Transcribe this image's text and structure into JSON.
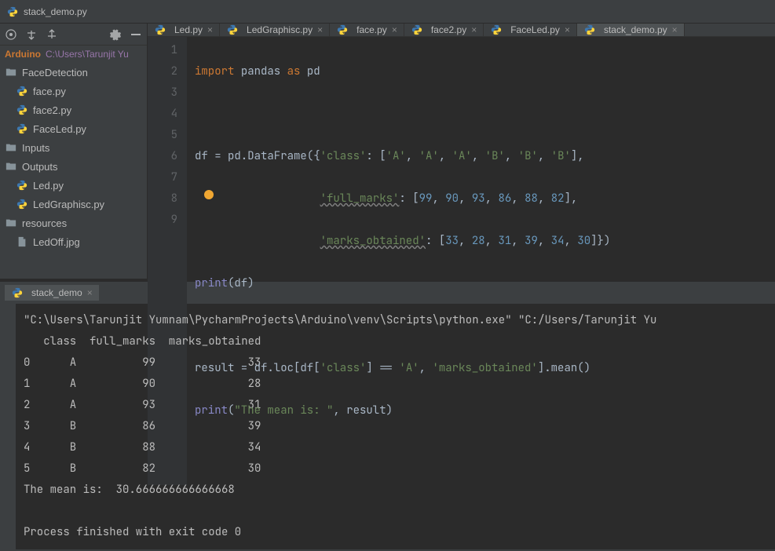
{
  "window": {
    "title": "stack_demo.py"
  },
  "project": {
    "name": "Arduino",
    "path": "C:\\Users\\Tarunjit Yu"
  },
  "tree": [
    {
      "type": "folder",
      "label": "FaceDetection",
      "indent": 0
    },
    {
      "type": "py",
      "label": "face.py",
      "indent": 1
    },
    {
      "type": "py",
      "label": "face2.py",
      "indent": 1
    },
    {
      "type": "py",
      "label": "FaceLed.py",
      "indent": 1
    },
    {
      "type": "folder",
      "label": "Inputs",
      "indent": 0
    },
    {
      "type": "folder",
      "label": "Outputs",
      "indent": 0
    },
    {
      "type": "py",
      "label": "Led.py",
      "indent": 1
    },
    {
      "type": "py",
      "label": "LedGraphisc.py",
      "indent": 1
    },
    {
      "type": "folder",
      "label": "resources",
      "indent": 0
    },
    {
      "type": "file",
      "label": "LedOff.jpg",
      "indent": 1
    }
  ],
  "tabs": [
    {
      "label": "Led.py",
      "active": false
    },
    {
      "label": "LedGraphisc.py",
      "active": false
    },
    {
      "label": "face.py",
      "active": false
    },
    {
      "label": "face2.py",
      "active": false
    },
    {
      "label": "FaceLed.py",
      "active": false
    },
    {
      "label": "stack_demo.py",
      "active": true
    }
  ],
  "code": {
    "lines": [
      "1",
      "2",
      "3",
      "4",
      "5",
      "6",
      "7",
      "8",
      "9"
    ],
    "l1_import": "import ",
    "l1_pandas": "pandas ",
    "l1_as": "as ",
    "l1_pd": "pd",
    "l3_a": "df = pd.DataFrame({",
    "l3_b": "'class'",
    "l3_c": ": [",
    "l3_d": "'A'",
    "l3_e": ", ",
    "l3_f": "'B'",
    "l3_g": "],",
    "l4_a": "                   ",
    "l4_b": "'full_marks'",
    "l4_c": ": [",
    "l4_n1": "99",
    "l4_n2": "90",
    "l4_n3": "93",
    "l4_n4": "86",
    "l4_n5": "88",
    "l4_n6": "82",
    "l4_d": "],",
    "l5_a": "                   ",
    "l5_b": "'marks_obtained'",
    "l5_c": ": [",
    "l5_n1": "33",
    "l5_n2": "28",
    "l5_n3": "31",
    "l5_n4": "39",
    "l5_n5": "34",
    "l5_n6": "30",
    "l5_d": "]})",
    "l6_print": "print",
    "l6_b": "(df)",
    "l8_a": "result = df.loc[df[",
    "l8_b": "'class'",
    "l8_c": "] == ",
    "l8_d": "'A'",
    "l8_e": ", ",
    "l8_f": "'marks_obtained'",
    "l8_g": "].mean()",
    "l9_print": "print",
    "l9_a": "(",
    "l9_b": "\"The mean is: \"",
    "l9_c": ", result)"
  },
  "run": {
    "tab": "stack_demo"
  },
  "console": {
    "cmd": "\"C:\\Users\\Tarunjit Yumnam\\PycharmProjects\\Arduino\\venv\\Scripts\\python.exe\" \"C:/Users/Tarunjit Yu",
    "header": "   class  full_marks  marks_obtained",
    "r0": "0      A          99              33",
    "r1": "1      A          90              28",
    "r2": "2      A          93              31",
    "r3": "3      B          86              39",
    "r4": "4      B          88              34",
    "r5": "5      B          82              30",
    "mean": "The mean is:  30.666666666666668",
    "exit": "Process finished with exit code 0"
  }
}
